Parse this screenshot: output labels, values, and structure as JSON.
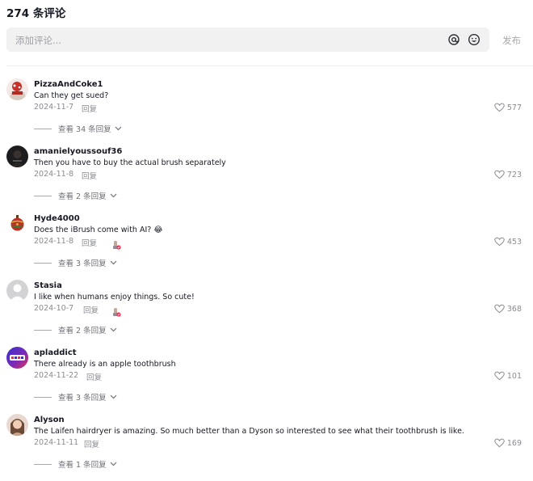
{
  "header": {
    "title": "274 条评论"
  },
  "input": {
    "placeholder": "添加评论...",
    "mention_icon": "at-icon",
    "emoji_icon": "emoji-icon"
  },
  "post_label": "发布",
  "colors": {
    "text": "#161823",
    "secondary": "#8a8b91",
    "input_bg": "#f1f1f2"
  },
  "comments": [
    {
      "username": "PizzaAndCoke1",
      "text": "Can they get sued?",
      "date": "2024-11-7",
      "reply": "回复",
      "likes": "577",
      "view_replies": "查看 34 条回复",
      "badge": false
    },
    {
      "username": "amanielyoussouf36",
      "text": "Then you have to buy the actual brush separately",
      "date": "2024-11-8",
      "reply": "回复",
      "likes": "723",
      "view_replies": "查看 2 条回复",
      "badge": false
    },
    {
      "username": "Hyde4000",
      "text": "Does the iBrush come with AI? 😂",
      "date": "2024-11-8",
      "reply": "回复",
      "likes": "453",
      "view_replies": "查看 3 条回复",
      "badge": true
    },
    {
      "username": "Stasia",
      "text": "I like when humans enjoy things. So cute!",
      "date": "2024-10-7",
      "reply": "回复",
      "likes": "368",
      "view_replies": "查看 2 条回复",
      "badge": true
    },
    {
      "username": "apladdict",
      "text": "There already is an apple toothbrush",
      "date": "2024-11-22",
      "reply": "回复",
      "likes": "101",
      "view_replies": "查看 3 条回复",
      "badge": false
    },
    {
      "username": "Alyson",
      "text": "The Laifen hairdryer is amazing. So much better than a Dyson so interested to see what their toothbrush is like.",
      "date": "2024-11-11",
      "reply": "回复",
      "likes": "169",
      "view_replies": "查看 1 条回复",
      "badge": false
    }
  ]
}
